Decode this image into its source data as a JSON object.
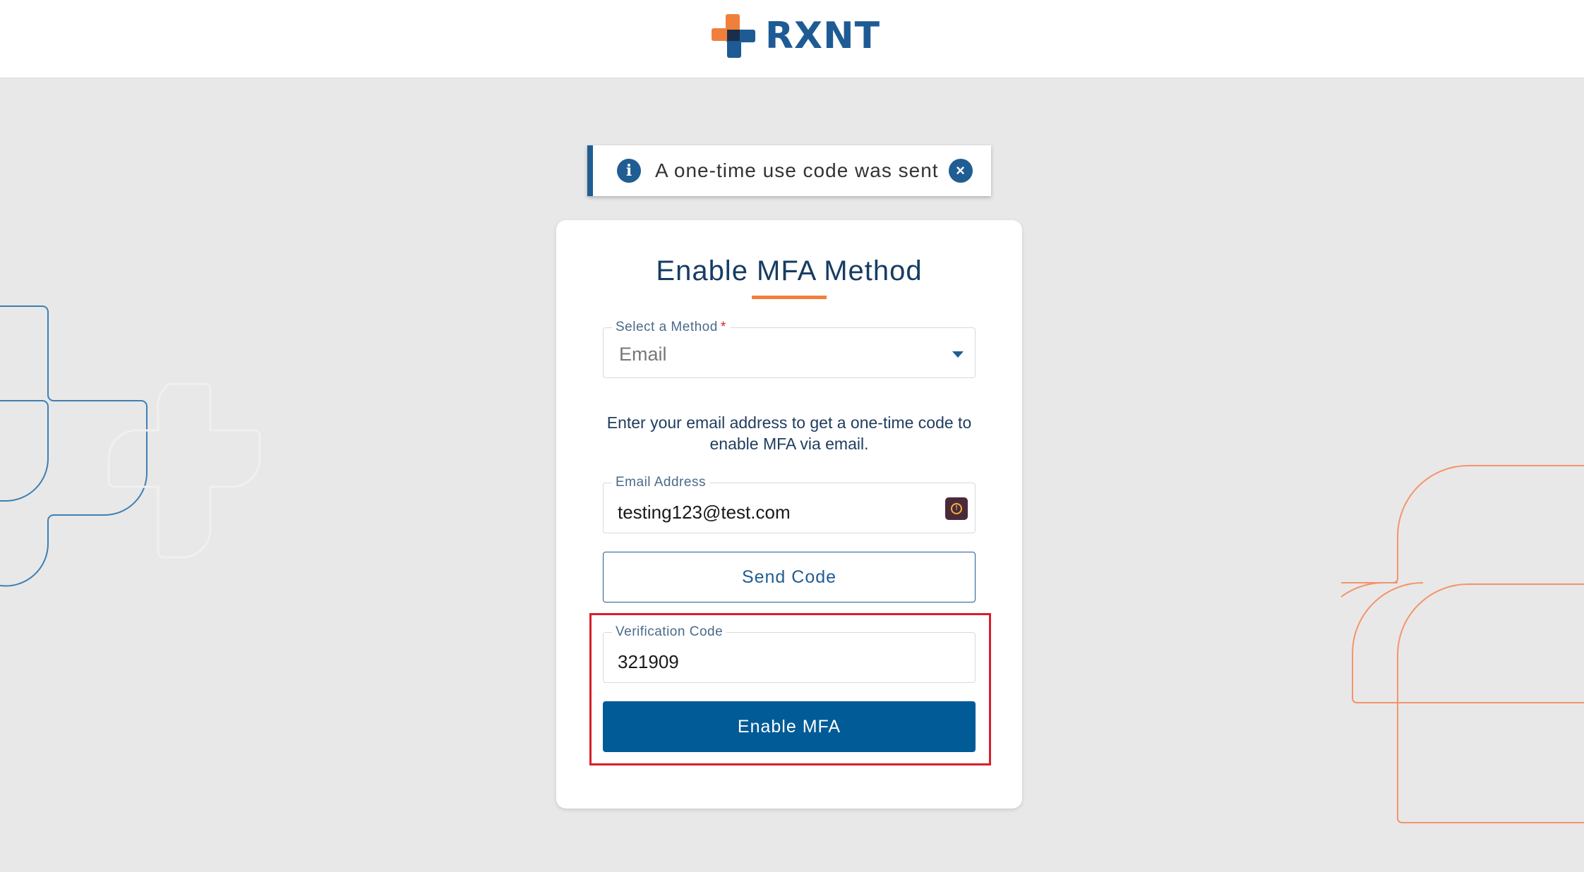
{
  "brand": {
    "name": "RXNT",
    "text_color": "#1e5b94",
    "icon": "rxnt-cross-logo-icon",
    "accent_orange": "#f07f3c",
    "accent_blue": "#1f5d93"
  },
  "toast": {
    "message": "A one-time use code was sent",
    "info_glyph": "i",
    "close_glyph": "×",
    "icons": [
      "info-icon",
      "close-icon"
    ]
  },
  "form": {
    "title": "Enable MFA Method",
    "method": {
      "label": "Select a Method",
      "required_mark": "*",
      "value": "Email",
      "icon": "chevron-down-icon"
    },
    "instructions": "Enter your email address to get a one-time code to enable MFA via email.",
    "email": {
      "label": "Email Address",
      "value": "testing123@test.com",
      "icon": "password-manager-icon",
      "icon_glyph": "!"
    },
    "send_code_label": "Send Code",
    "verification": {
      "label": "Verification Code",
      "value": "321909"
    },
    "enable_label": "Enable MFA"
  },
  "colors": {
    "page_background": "#e8e8e8",
    "primary_button": "#005b96",
    "highlight_border": "#d91e2a"
  }
}
